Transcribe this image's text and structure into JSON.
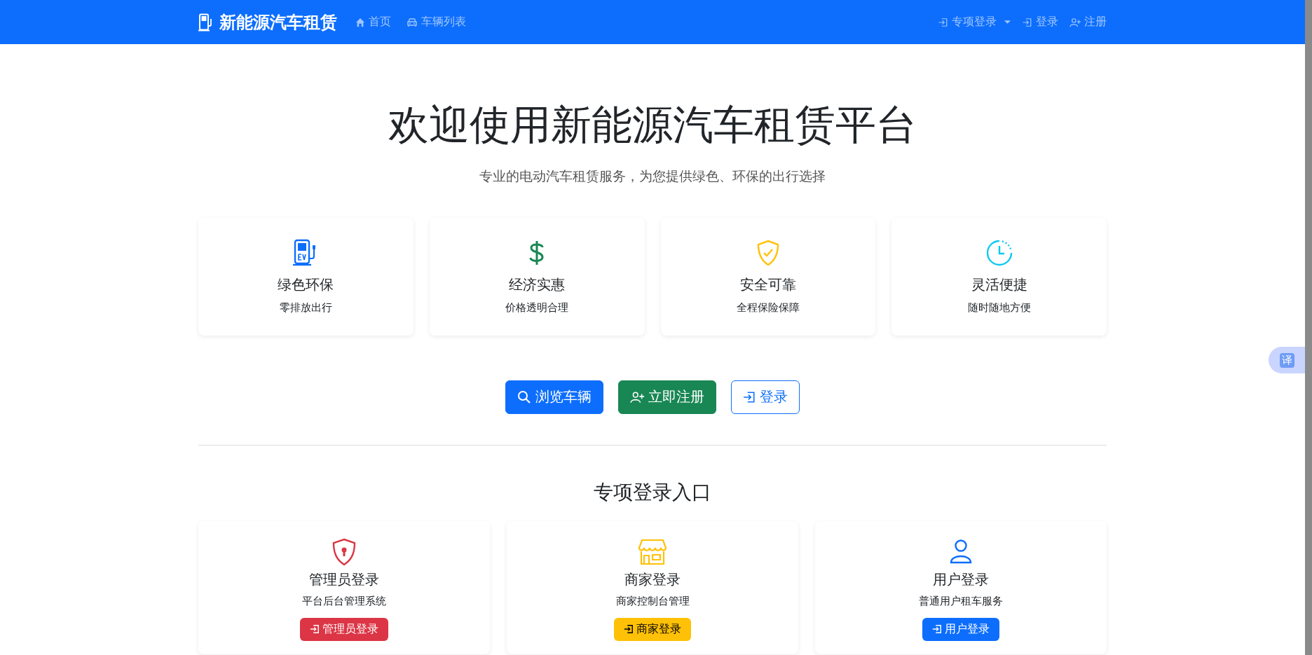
{
  "navbar": {
    "brand": "新能源汽车租赁",
    "links": [
      {
        "label": "首页",
        "selected": false
      },
      {
        "label": "车辆列表",
        "selected": false
      }
    ],
    "right_links": [
      {
        "label": "专项登录",
        "kind": "dropdown"
      },
      {
        "label": "登录",
        "kind": "link"
      },
      {
        "label": "注册",
        "kind": "link"
      }
    ]
  },
  "hero": {
    "title": "欢迎使用新能源汽车租赁平台",
    "subtitle": "专业的电动汽车租赁服务，为您提供绿色、环保的出行选择"
  },
  "features": [
    {
      "title": "绿色环保",
      "text": "零排放出行",
      "color": "#0d6efd"
    },
    {
      "title": "经济实惠",
      "text": "价格透明合理",
      "color": "#198754"
    },
    {
      "title": "安全可靠",
      "text": "全程保险保障",
      "color": "#ffc107"
    },
    {
      "title": "灵活便捷",
      "text": "随时随地方便",
      "color": "#0dcaf0"
    }
  ],
  "actions": [
    {
      "label": "浏览车辆",
      "kind": "primary"
    },
    {
      "label": "立即注册",
      "kind": "success"
    },
    {
      "label": "登录",
      "kind": "outline"
    }
  ],
  "login_section": {
    "title": "专项登录入口",
    "cards": [
      {
        "title": "管理员登录",
        "text": "平台后台管理系统",
        "button": "管理员登录",
        "color": "#dc3545"
      },
      {
        "title": "商家登录",
        "text": "商家控制台管理",
        "button": "商家登录",
        "color": "#ffc107"
      },
      {
        "title": "用户登录",
        "text": "普通用户租车服务",
        "button": "用户登录",
        "color": "#0d6efd"
      }
    ]
  },
  "translate_widget": {
    "label": "译"
  }
}
